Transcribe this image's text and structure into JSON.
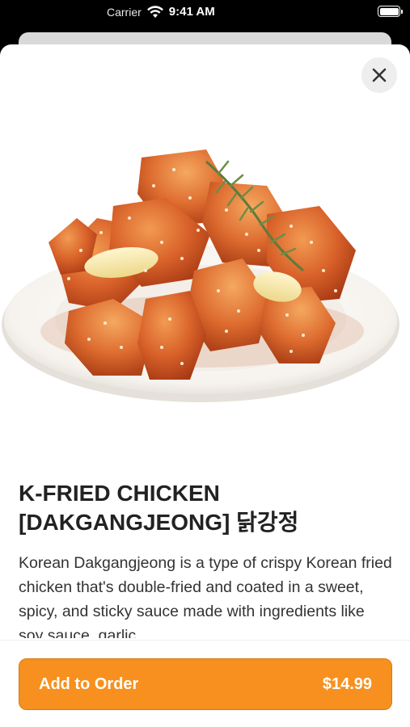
{
  "status_bar": {
    "carrier": "Carrier",
    "time": "9:41 AM",
    "icons": [
      "wifi-icon",
      "battery-icon"
    ]
  },
  "modal": {
    "close_icon": "close-icon",
    "image_alt": "Plate of Korean fried chicken glazed in red sauce with sesame seeds, garlic and rosemary",
    "item": {
      "title_line1": "K-FRIED CHICKEN",
      "title_line2": "[DAKGANGJEONG] 닭강정",
      "description": "Korean Dakgangjeong is a type of crispy Korean fried chicken that's double-fried and coated in a sweet, spicy, and sticky sauce made with ingredients like soy sauce, garlic"
    },
    "footer": {
      "add_label": "Add to Order",
      "price": "$14.99"
    }
  },
  "colors": {
    "accent": "#f7901e",
    "title_text": "#222222",
    "body_text": "#333333",
    "close_bg": "#eeeeee"
  }
}
